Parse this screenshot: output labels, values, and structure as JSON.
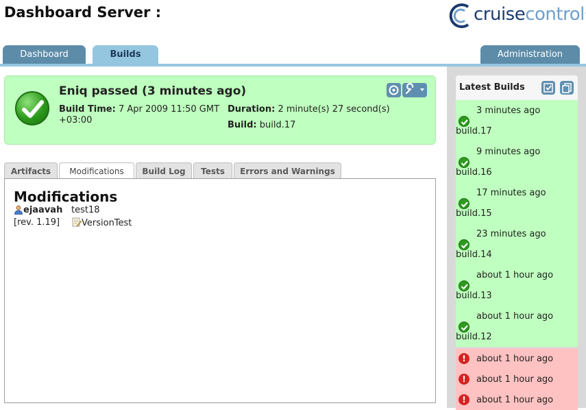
{
  "header": {
    "title": "Dashboard Server :",
    "logo": {
      "part1": "cruise",
      "part2": "control",
      "mark": "."
    }
  },
  "nav": {
    "dashboard": "Dashboard",
    "builds": "Builds",
    "administration": "Administration"
  },
  "status": {
    "title": "Eniq passed (3 minutes ago)",
    "build_time_label": "Build Time:",
    "build_time_value": "7 Apr 2009 11:50 GMT +03:00",
    "duration_label": "Duration:",
    "duration_value": "2 minute(s) 27 second(s)",
    "build_label": "Build:",
    "build_value": "build.17",
    "icons": [
      "force-build-icon",
      "config-icon"
    ]
  },
  "subtabs": {
    "artifacts": "Artifacts",
    "modifications": "Modifications",
    "build_log": "Build Log",
    "tests": "Tests",
    "errors": "Errors and Warnings"
  },
  "modifications": {
    "heading": "Modifications",
    "user": "ejaavah",
    "comment": "test18",
    "revision": "[rev. 1.19]",
    "file": "VersionTest"
  },
  "latest_builds": {
    "title": "Latest Builds",
    "items": [
      {
        "time": "3 minutes ago",
        "name": "build.17",
        "status": "passed"
      },
      {
        "time": "9 minutes ago",
        "name": "build.16",
        "status": "passed"
      },
      {
        "time": "17 minutes ago",
        "name": "build.15",
        "status": "passed"
      },
      {
        "time": "23 minutes ago",
        "name": "build.14",
        "status": "passed"
      },
      {
        "time": "about 1 hour ago",
        "name": "build.13",
        "status": "passed"
      },
      {
        "time": "about 1 hour ago",
        "name": "build.12",
        "status": "passed"
      },
      {
        "time": "about 1 hour ago",
        "status": "failed"
      },
      {
        "time": "about 1 hour ago",
        "status": "failed"
      },
      {
        "time": "about 1 hour ago",
        "status": "failed"
      }
    ]
  },
  "colors": {
    "passed": "#bfffbf",
    "failed": "#ffc2c2",
    "tab_blue": "#5d8ca9",
    "tab_active": "#95c6e0"
  }
}
